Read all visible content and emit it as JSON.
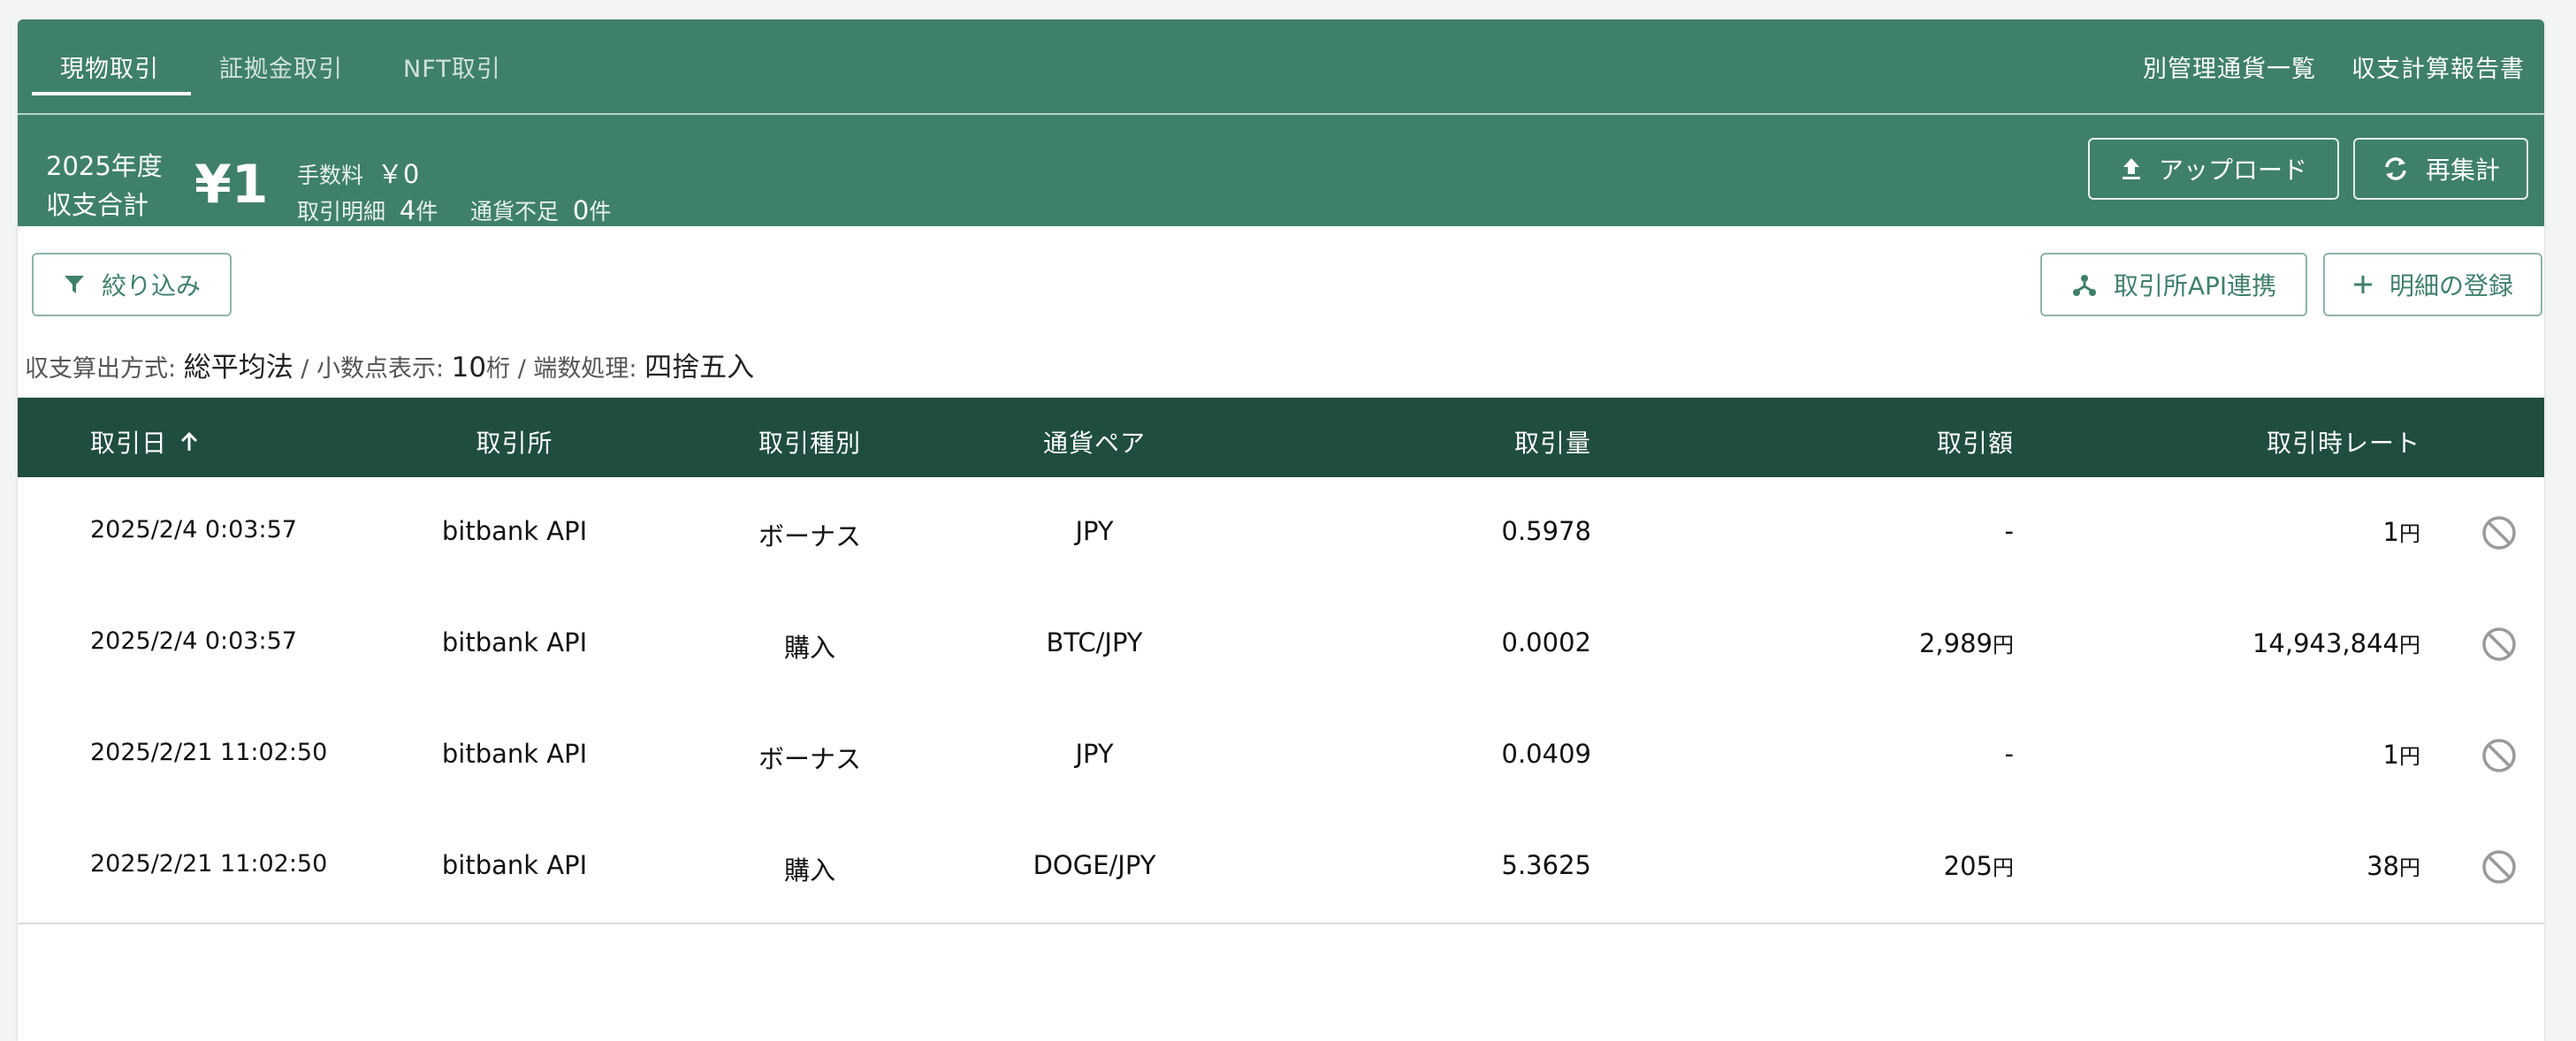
{
  "tabs": [
    "現物取引",
    "証拠金取引",
    "NFT取引"
  ],
  "top_links": [
    "別管理通貨一覧",
    "収支計算報告書"
  ],
  "summary": {
    "year_line1": "2025年度",
    "year_line2": "収支合計",
    "total": "¥1",
    "fee_label": "手数料",
    "fee_value": "￥0",
    "tx_label": "取引明細",
    "tx_count": "4",
    "count_unit": "件",
    "shortage_label": "通貨不足",
    "shortage_count": "0"
  },
  "buttons": {
    "upload": "アップロード",
    "recalc": "再集計",
    "filter": "絞り込み",
    "api": "取引所API連携",
    "add": "明細の登録"
  },
  "settings": {
    "method_label": "収支算出方式:",
    "method_value": "総平均法",
    "decimal_label": "/ 小数点表示:",
    "decimal_value": "10",
    "decimal_unit": "桁",
    "rounding_label": "/ 端数処理:",
    "rounding_value": "四捨五入"
  },
  "table": {
    "headers": [
      "取引日",
      "取引所",
      "取引種別",
      "通貨ペア",
      "取引量",
      "取引額",
      "取引時レート"
    ],
    "yen_unit": "円",
    "rows": [
      {
        "date": "2025/2/4 0:03:57",
        "exchange": "bitbank API",
        "type": "ボーナス",
        "pair": "JPY",
        "qty": "0.5978",
        "amount": "-",
        "amount_unit": "",
        "rate": "1"
      },
      {
        "date": "2025/2/4 0:03:57",
        "exchange": "bitbank API",
        "type": "購入",
        "pair": "BTC/JPY",
        "qty": "0.0002",
        "amount": "2,989",
        "amount_unit": "円",
        "rate": "14,943,844"
      },
      {
        "date": "2025/2/21 11:02:50",
        "exchange": "bitbank API",
        "type": "ボーナス",
        "pair": "JPY",
        "qty": "0.0409",
        "amount": "-",
        "amount_unit": "",
        "rate": "1"
      },
      {
        "date": "2025/2/21 11:02:50",
        "exchange": "bitbank API",
        "type": "購入",
        "pair": "DOGE/JPY",
        "qty": "5.3625",
        "amount": "205",
        "amount_unit": "円",
        "rate": "38"
      }
    ]
  },
  "icons": {
    "upload": "upload-icon",
    "recalc": "refresh-icon",
    "filter": "filter-icon",
    "api": "api-link-icon",
    "add": "plus-icon",
    "sort": "sort-arrow-up-icon",
    "exclude": "prohibit-icon"
  },
  "colors": {
    "header_green": "#3f8069",
    "table_header": "#1f4d3f",
    "button_text_green": "#3f8069"
  }
}
